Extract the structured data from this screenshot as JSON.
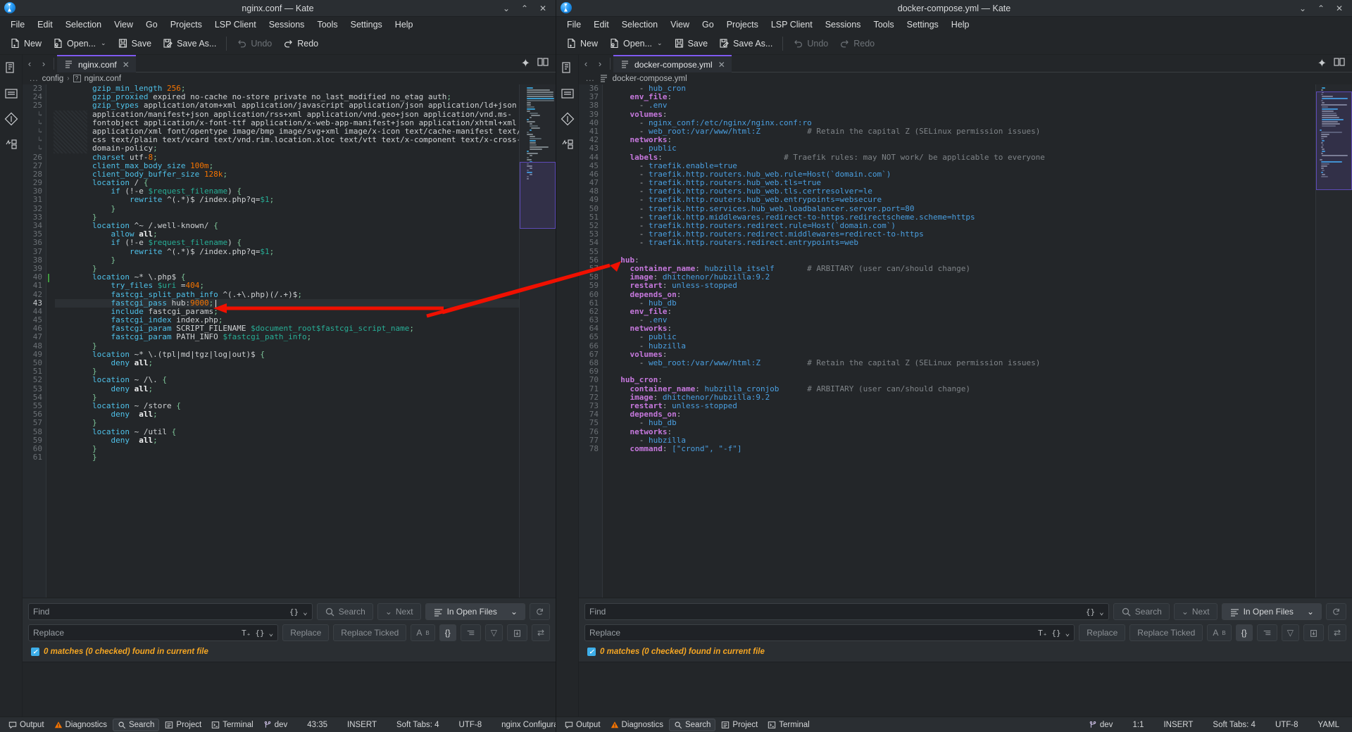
{
  "left_window": {
    "title": "nginx.conf — Kate",
    "menus": [
      "File",
      "Edit",
      "Selection",
      "View",
      "Go",
      "Projects",
      "LSP Client",
      "Sessions",
      "Tools",
      "Settings",
      "Help"
    ],
    "toolbar": [
      {
        "label": "New",
        "icon": "new-file-icon",
        "disabled": false
      },
      {
        "label": "Open...",
        "icon": "open-folder-icon",
        "disabled": false,
        "has_arrow": true
      },
      {
        "label": "Save",
        "icon": "save-disk-icon",
        "disabled": false
      },
      {
        "label": "Save As...",
        "icon": "save-as-icon",
        "disabled": false
      },
      {
        "label": "Undo",
        "icon": "undo-icon",
        "disabled": true
      },
      {
        "label": "Redo",
        "icon": "redo-icon",
        "disabled": false
      }
    ],
    "tab": {
      "label": "nginx.conf",
      "close": "✕"
    },
    "breadcrumb": {
      "dots": "...",
      "parts": [
        "config",
        "nginx.conf"
      ],
      "sep": "›"
    },
    "find": {
      "find_placeholder": "Find",
      "replace_placeholder": "Replace",
      "search_label": "Search",
      "next_label": "Next",
      "scope_label": "In Open Files",
      "replace_label": "Replace",
      "replace_ticked_label": "Replace Ticked",
      "status": "0 matches (0 checked) found in current file"
    },
    "status_bar": {
      "left_items": [
        "Output",
        "Diagnostics",
        "Search",
        "Project",
        "Terminal"
      ],
      "selected": "Search",
      "branch": "dev",
      "cursor": "43:35",
      "mode": "INSERT",
      "tabs": "Soft Tabs: 4",
      "encoding": "UTF-8",
      "syntax": "nginx Configuration"
    },
    "code_lines": [
      {
        "num": "23",
        "html": "        <span class=\"k\">gzip_min_length</span> <span class=\"n\">256</span><span class=\"br\">;</span>"
      },
      {
        "num": "24",
        "html": "        <span class=\"k\">gzip_proxied</span> <span class=\"v\">expired no-cache no-store private no_last_modified no_etag auth</span><span class=\"br\">;</span>"
      },
      {
        "num": "25",
        "html": "        <span class=\"k\">gzip_types</span> <span class=\"v\">application/atom+xml application/javascript application/json application/ld+json</span>"
      },
      {
        "num": "↳",
        "wrap": true,
        "html": "        <span class=\"v\">application/manifest+json application/rss+xml application/vnd.geo+json application/vnd.ms-</span>"
      },
      {
        "num": "↳",
        "wrap": true,
        "html": "        <span class=\"v\">fontobject application/x-font-ttf application/x-web-app-manifest+json application/xhtml+xml</span>"
      },
      {
        "num": "↳",
        "wrap": true,
        "html": "        <span class=\"v\">application/xml font/opentype image/bmp image/svg+xml image/x-icon text/cache-manifest text/</span>"
      },
      {
        "num": "↳",
        "wrap": true,
        "html": "        <span class=\"v\">css text/plain text/vcard text/vnd.rim.location.xloc text/vtt text/x-component text/x-cross-</span>"
      },
      {
        "num": "↳",
        "wrap": true,
        "html": "        <span class=\"v\">domain-policy</span><span class=\"br\">;</span>"
      },
      {
        "num": "26",
        "html": "        <span class=\"k\">charset</span> <span class=\"v\">utf-</span><span class=\"n\">8</span><span class=\"br\">;</span>"
      },
      {
        "num": "27",
        "html": "        <span class=\"k\">client_max_body_size</span> <span class=\"n\">100m</span><span class=\"br\">;</span>"
      },
      {
        "num": "28",
        "html": "        <span class=\"k\">client_body_buffer_size</span> <span class=\"n\">128k</span><span class=\"br\">;</span>"
      },
      {
        "num": "29",
        "html": "        <span class=\"k\">location</span> <span class=\"v\">/</span> <span class=\"br\">{</span>"
      },
      {
        "num": "30",
        "html": "            <span class=\"k\">if</span> <span class=\"v\">(!-e </span><span class=\"var\">$request_filename</span><span class=\"v\">)</span> <span class=\"br\">{</span>"
      },
      {
        "num": "31",
        "html": "                <span class=\"k\">rewrite</span> <span class=\"v\">^(.*)$ /index.php?q=</span><span class=\"var\">$1</span><span class=\"br\">;</span>"
      },
      {
        "num": "32",
        "html": "            <span class=\"br\">}</span>"
      },
      {
        "num": "33",
        "html": "        <span class=\"br\">}</span>"
      },
      {
        "num": "34",
        "html": "        <span class=\"k\">location</span> <span class=\"v\">^~ /.well-known/</span> <span class=\"br\">{</span>"
      },
      {
        "num": "35",
        "html": "            <span class=\"k\">allow</span> <span class=\"b\">all</span><span class=\"br\">;</span>"
      },
      {
        "num": "36",
        "html": "            <span class=\"k\">if</span> <span class=\"v\">(!-e </span><span class=\"var\">$request_filename</span><span class=\"v\">)</span> <span class=\"br\">{</span>"
      },
      {
        "num": "37",
        "html": "                <span class=\"k\">rewrite</span> <span class=\"v\">^(.*)$ /index.php?q=</span><span class=\"var\">$1</span><span class=\"br\">;</span>"
      },
      {
        "num": "38",
        "html": "            <span class=\"br\">}</span>"
      },
      {
        "num": "39",
        "html": "        <span class=\"br\">}</span>"
      },
      {
        "num": "40",
        "html": "        <span class=\"k\">location</span> <span class=\"v\">~* \\.php$</span> <span class=\"br\">{</span>"
      },
      {
        "num": "41",
        "html": "            <span class=\"k\">try_files</span> <span class=\"var\">$uri</span> <span class=\"v\">=</span><span class=\"n\">404</span><span class=\"br\">;</span>"
      },
      {
        "num": "42",
        "html": "            <span class=\"k\">fastcgi_split_path_info</span> <span class=\"v\">^(.+\\.php)(/.+)$</span><span class=\"br\">;</span>"
      },
      {
        "num": "43",
        "cur": true,
        "html": "            <span class=\"k\">fastcgi_pass</span> <span class=\"v\">hub:</span><span class=\"n\">9000</span><span class=\"br\">;</span><span class=\"caret\">|</span>"
      },
      {
        "num": "44",
        "html": "            <span class=\"k\">include</span> <span class=\"v\">fastcgi_params</span><span class=\"br\">;</span>"
      },
      {
        "num": "45",
        "html": "            <span class=\"k\">fastcgi_index</span> <span class=\"v\">index.php</span><span class=\"br\">;</span>"
      },
      {
        "num": "46",
        "html": "            <span class=\"k\">fastcgi_param</span> <span class=\"v\">SCRIPT_FILENAME </span><span class=\"var\">$document_root$fastcgi_script_name</span><span class=\"br\">;</span>"
      },
      {
        "num": "47",
        "html": "            <span class=\"k\">fastcgi_param</span> <span class=\"v\">PATH_INFO </span><span class=\"var\">$fastcgi_path_info</span><span class=\"br\">;</span>"
      },
      {
        "num": "48",
        "html": "        <span class=\"br\">}</span>"
      },
      {
        "num": "49",
        "html": "        <span class=\"k\">location</span> <span class=\"v\">~* \\.(tpl|md|tgz|log|out)$</span> <span class=\"br\">{</span>"
      },
      {
        "num": "50",
        "html": "            <span class=\"k\">deny</span> <span class=\"b\">all</span><span class=\"br\">;</span>"
      },
      {
        "num": "51",
        "html": "        <span class=\"br\">}</span>"
      },
      {
        "num": "52",
        "html": "        <span class=\"k\">location</span> <span class=\"v\">~ /\\.</span> <span class=\"br\">{</span>"
      },
      {
        "num": "53",
        "html": "            <span class=\"k\">deny</span> <span class=\"b\">all</span><span class=\"br\">;</span>"
      },
      {
        "num": "54",
        "html": "        <span class=\"br\">}</span>"
      },
      {
        "num": "55",
        "html": "        <span class=\"k\">location</span> <span class=\"v\">~ /store</span> <span class=\"br\">{</span>"
      },
      {
        "num": "56",
        "html": "            <span class=\"k\">deny</span>  <span class=\"b\">all</span><span class=\"br\">;</span>"
      },
      {
        "num": "57",
        "html": "        <span class=\"br\">}</span>"
      },
      {
        "num": "58",
        "html": "        <span class=\"k\">location</span> <span class=\"v\">~ /util</span> <span class=\"br\">{</span>"
      },
      {
        "num": "59",
        "html": "            <span class=\"k\">deny</span>  <span class=\"b\">all</span><span class=\"br\">;</span>"
      },
      {
        "num": "60",
        "html": "        <span class=\"br\">}</span>"
      },
      {
        "num": "61",
        "html": "        <span class=\"br\">}</span>"
      }
    ]
  },
  "right_window": {
    "title": "docker-compose.yml — Kate",
    "menus": [
      "File",
      "Edit",
      "Selection",
      "View",
      "Go",
      "Projects",
      "LSP Client",
      "Sessions",
      "Tools",
      "Settings",
      "Help"
    ],
    "toolbar": [
      {
        "label": "New",
        "icon": "new-file-icon",
        "disabled": false
      },
      {
        "label": "Open...",
        "icon": "open-folder-icon",
        "disabled": false,
        "has_arrow": true
      },
      {
        "label": "Save",
        "icon": "save-disk-icon",
        "disabled": false
      },
      {
        "label": "Save As...",
        "icon": "save-as-icon",
        "disabled": false
      },
      {
        "label": "Undo",
        "icon": "undo-icon",
        "disabled": true
      },
      {
        "label": "Redo",
        "icon": "redo-icon",
        "disabled": true
      }
    ],
    "tab": {
      "label": "docker-compose.yml",
      "close": "✕"
    },
    "breadcrumb": {
      "dots": "...",
      "parts": [
        "docker-compose.yml"
      ],
      "sep": "›"
    },
    "find": {
      "find_placeholder": "Find",
      "replace_placeholder": "Replace",
      "search_label": "Search",
      "next_label": "Next",
      "scope_label": "In Open Files",
      "replace_label": "Replace",
      "replace_ticked_label": "Replace Ticked",
      "status": "0 matches (0 checked) found in current file"
    },
    "status_bar": {
      "left_items": [
        "Output",
        "Diagnostics",
        "Search",
        "Project",
        "Terminal"
      ],
      "selected": "Search",
      "branch": "dev",
      "cursor": "1:1",
      "mode": "INSERT",
      "tabs": "Soft Tabs: 4",
      "encoding": "UTF-8",
      "syntax": "YAML"
    },
    "code_lines": [
      {
        "num": "36",
        "html": "      <span class=\"ydash\">-</span> <span class=\"yval\">hub_cron</span>"
      },
      {
        "num": "37",
        "html": "    <span class=\"ykey\">env_file</span><span class=\"ydash\">:</span>"
      },
      {
        "num": "38",
        "html": "      <span class=\"ydash\">-</span> <span class=\"yval\">.env</span>"
      },
      {
        "num": "39",
        "html": "    <span class=\"ykey\">volumes</span><span class=\"ydash\">:</span>"
      },
      {
        "num": "40",
        "html": "      <span class=\"ydash\">-</span> <span class=\"yval\">nginx_conf:/etc/nginx/nginx.conf:ro</span>"
      },
      {
        "num": "41",
        "html": "      <span class=\"ydash\">-</span> <span class=\"yval\">web_root:/var/www/html:Z</span>          <span class=\"ycom\"># Retain the capital Z (SELinux permission issues)</span>"
      },
      {
        "num": "42",
        "html": "    <span class=\"ykey\">networks</span><span class=\"ydash\">:</span>"
      },
      {
        "num": "43",
        "html": "      <span class=\"ydash\">-</span> <span class=\"yval\">public</span>"
      },
      {
        "num": "44",
        "html": "    <span class=\"ykey\">labels</span><span class=\"ydash\">:</span>                          <span class=\"ycom\"># Traefik rules: may NOT work/ be applicable to everyone</span>"
      },
      {
        "num": "45",
        "html": "      <span class=\"ydash\">-</span> <span class=\"yval\">traefik.enable=true</span>"
      },
      {
        "num": "46",
        "html": "      <span class=\"ydash\">-</span> <span class=\"yval\">traefik.http.routers.hub_web.rule=Host(`domain.com`)</span>"
      },
      {
        "num": "47",
        "html": "      <span class=\"ydash\">-</span> <span class=\"yval\">traefik.http.routers.hub_web.tls=true</span>"
      },
      {
        "num": "48",
        "html": "      <span class=\"ydash\">-</span> <span class=\"yval\">traefik.http.routers.hub_web.tls.certresolver=le</span>"
      },
      {
        "num": "49",
        "html": "      <span class=\"ydash\">-</span> <span class=\"yval\">traefik.http.routers.hub_web.entrypoints=websecure</span>"
      },
      {
        "num": "50",
        "html": "      <span class=\"ydash\">-</span> <span class=\"yval\">traefik.http.services.hub_web.loadbalancer.server.port=80</span>"
      },
      {
        "num": "51",
        "html": "      <span class=\"ydash\">-</span> <span class=\"yval\">traefik.http.middlewares.redirect-to-https.redirectscheme.scheme=https</span>"
      },
      {
        "num": "52",
        "html": "      <span class=\"ydash\">-</span> <span class=\"yval\">traefik.http.routers.redirect.rule=Host(`domain.com`)</span>"
      },
      {
        "num": "53",
        "html": "      <span class=\"ydash\">-</span> <span class=\"yval\">traefik.http.routers.redirect.middlewares=redirect-to-https</span>"
      },
      {
        "num": "54",
        "html": "      <span class=\"ydash\">-</span> <span class=\"yval\">traefik.http.routers.redirect.entrypoints=web</span>"
      },
      {
        "num": "55",
        "html": ""
      },
      {
        "num": "56",
        "html": "  <span class=\"ykey\">hub</span><span class=\"ydash\">:</span>"
      },
      {
        "num": "57",
        "html": "    <span class=\"ykey\">container_name</span><span class=\"ydash\">:</span> <span class=\"yval\">hubzilla_itself</span>       <span class=\"ycom\"># ARBITARY (user can/should change)</span>"
      },
      {
        "num": "58",
        "html": "    <span class=\"ykey\">image</span><span class=\"ydash\">:</span> <span class=\"yval\">dhitchenor/hubzilla:9.2</span>"
      },
      {
        "num": "59",
        "html": "    <span class=\"ykey\">restart</span><span class=\"ydash\">:</span> <span class=\"yval\">unless-stopped</span>"
      },
      {
        "num": "60",
        "html": "    <span class=\"ykey\">depends_on</span><span class=\"ydash\">:</span>"
      },
      {
        "num": "61",
        "html": "      <span class=\"ydash\">-</span> <span class=\"yval\">hub_db</span>"
      },
      {
        "num": "62",
        "html": "    <span class=\"ykey\">env_file</span><span class=\"ydash\">:</span>"
      },
      {
        "num": "63",
        "html": "      <span class=\"ydash\">-</span> <span class=\"yval\">.env</span>"
      },
      {
        "num": "64",
        "html": "    <span class=\"ykey\">networks</span><span class=\"ydash\">:</span>"
      },
      {
        "num": "65",
        "html": "      <span class=\"ydash\">-</span> <span class=\"yval\">public</span>"
      },
      {
        "num": "66",
        "html": "      <span class=\"ydash\">-</span> <span class=\"yval\">hubzilla</span>"
      },
      {
        "num": "67",
        "html": "    <span class=\"ykey\">volumes</span><span class=\"ydash\">:</span>"
      },
      {
        "num": "68",
        "html": "      <span class=\"ydash\">-</span> <span class=\"yval\">web_root:/var/www/html:Z</span>          <span class=\"ycom\"># Retain the capital Z (SELinux permission issues)</span>"
      },
      {
        "num": "69",
        "html": ""
      },
      {
        "num": "70",
        "html": "  <span class=\"ykey\">hub_cron</span><span class=\"ydash\">:</span>"
      },
      {
        "num": "71",
        "html": "    <span class=\"ykey\">container_name</span><span class=\"ydash\">:</span> <span class=\"yval\">hubzilla_cronjob</span>      <span class=\"ycom\"># ARBITARY (user can/should change)</span>"
      },
      {
        "num": "72",
        "html": "    <span class=\"ykey\">image</span><span class=\"ydash\">:</span> <span class=\"yval\">dhitchenor/hubzilla:9.2</span>"
      },
      {
        "num": "73",
        "html": "    <span class=\"ykey\">restart</span><span class=\"ydash\">:</span> <span class=\"yval\">unless-stopped</span>"
      },
      {
        "num": "74",
        "html": "    <span class=\"ykey\">depends_on</span><span class=\"ydash\">:</span>"
      },
      {
        "num": "75",
        "html": "      <span class=\"ydash\">-</span> <span class=\"yval\">hub_db</span>"
      },
      {
        "num": "76",
        "html": "    <span class=\"ykey\">networks</span><span class=\"ydash\">:</span>"
      },
      {
        "num": "77",
        "html": "      <span class=\"ydash\">-</span> <span class=\"yval\">hubzilla</span>"
      },
      {
        "num": "78",
        "html": "    <span class=\"ykey\">command</span><span class=\"ydash\">:</span> <span class=\"ystr\">[\"crond\", \"-f\"]</span>"
      }
    ]
  },
  "annotation": {
    "arrow_color": "#f01000",
    "description": "red-arrow-from-hub-service-to-fastcgi-pass"
  }
}
